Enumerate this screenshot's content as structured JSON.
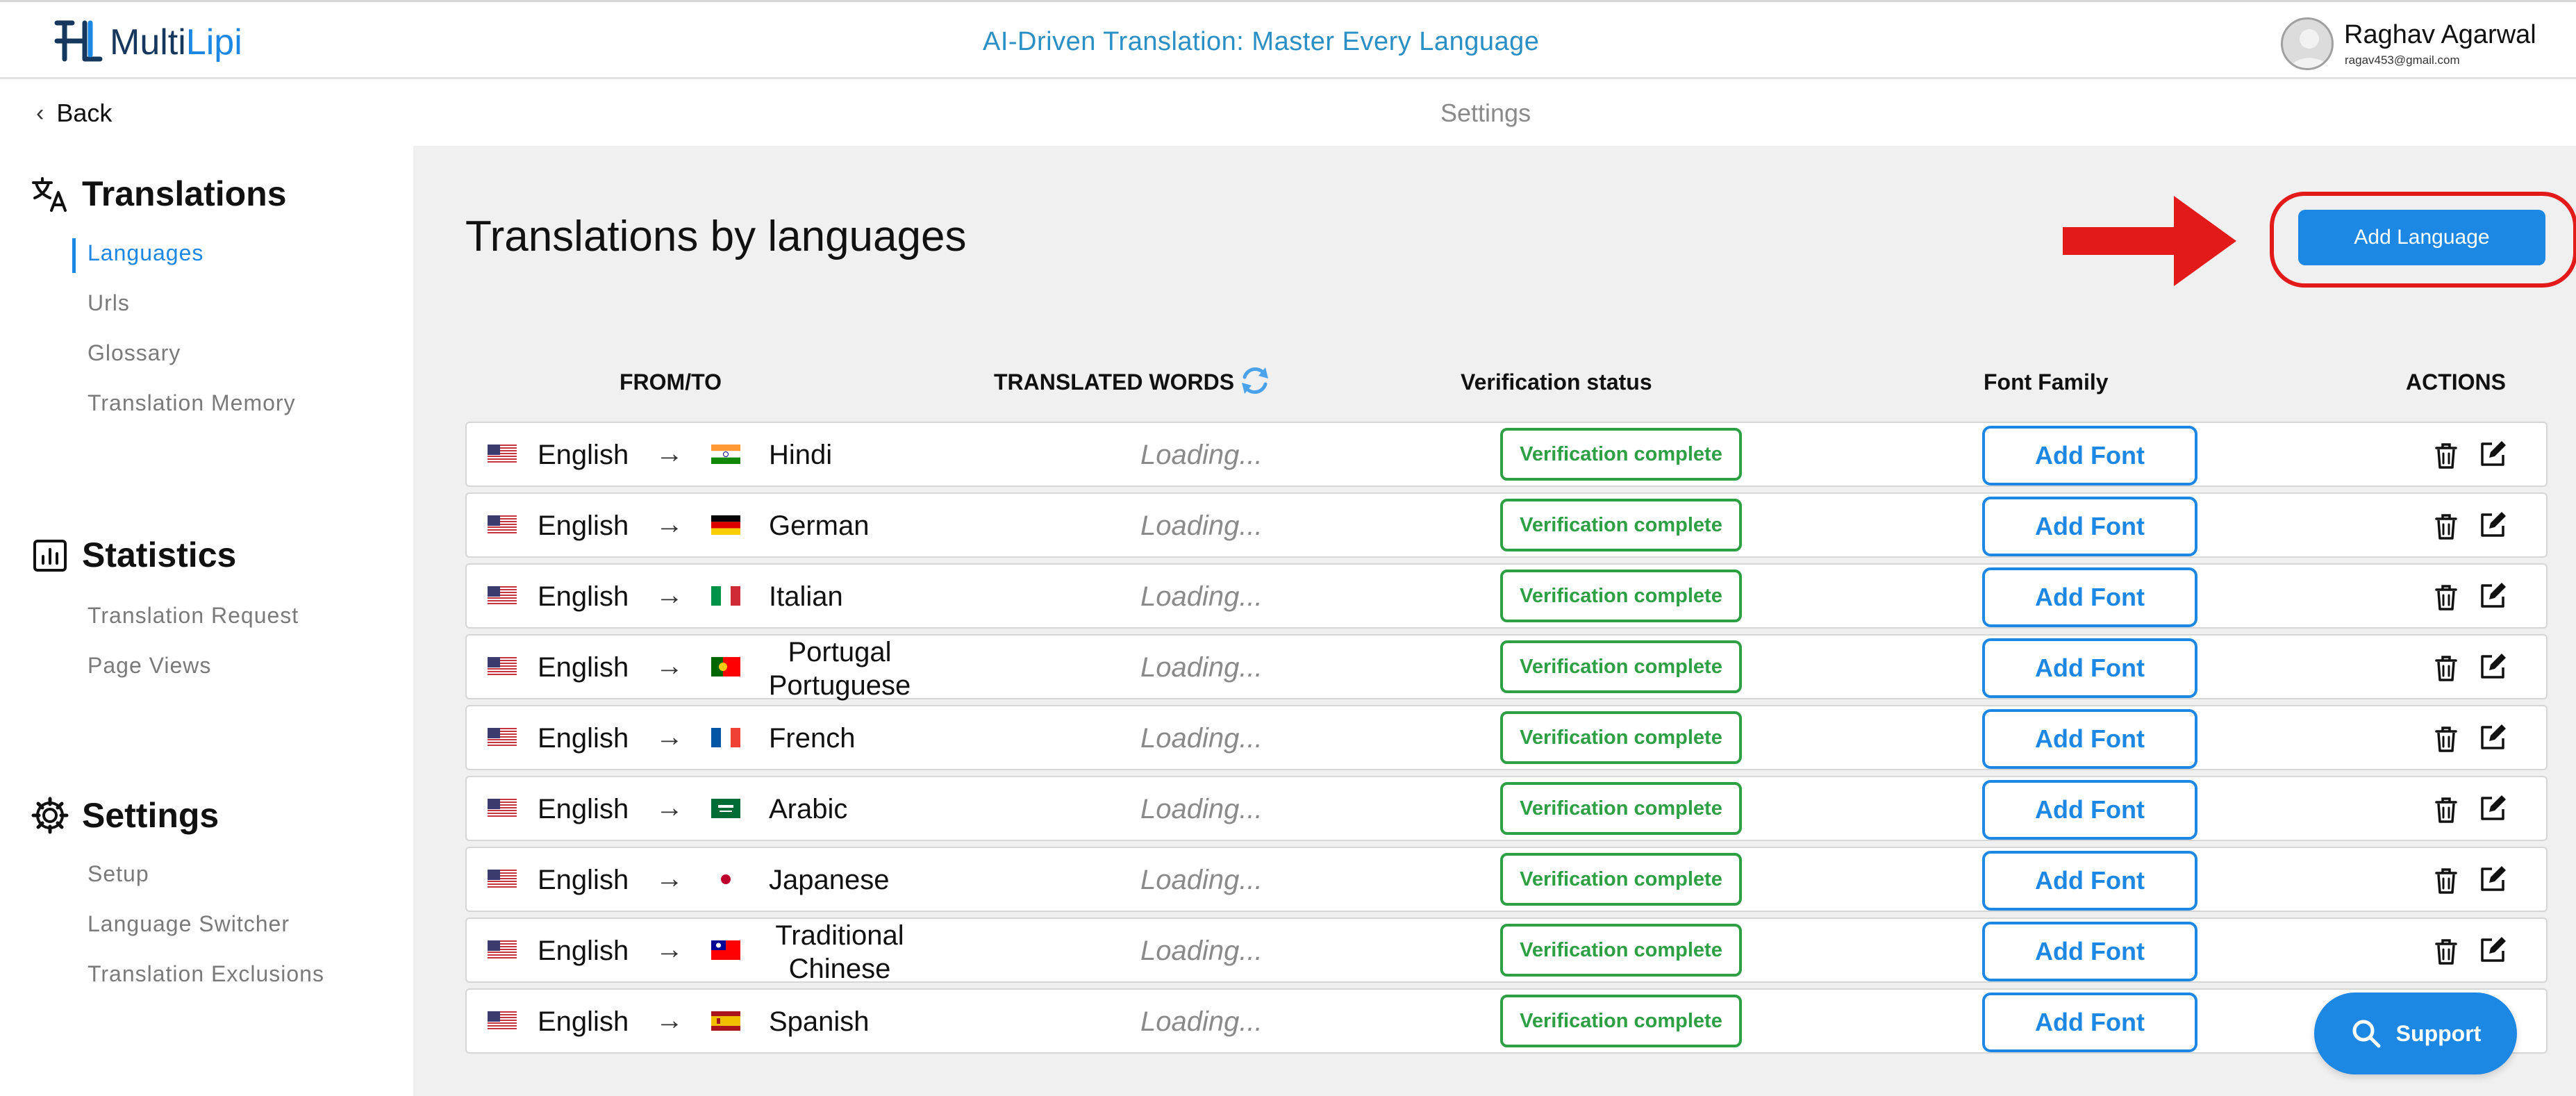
{
  "header": {
    "brand_multi": "Multi",
    "brand_lipi": "Lipi",
    "tagline": "AI-Driven Translation: Master Every Language",
    "user_name": "Raghav Agarwal",
    "user_email": "ragav453@gmail.com"
  },
  "subheader": {
    "back_label": "Back",
    "page_label": "Settings"
  },
  "sidebar": {
    "translations": {
      "title": "Translations",
      "items": [
        "Languages",
        "Urls",
        "Glossary",
        "Translation Memory"
      ],
      "active": "Languages"
    },
    "statistics": {
      "title": "Statistics",
      "items": [
        "Translation Request",
        "Page Views"
      ]
    },
    "settings": {
      "title": "Settings",
      "items": [
        "Setup",
        "Language Switcher",
        "Translation Exclusions"
      ]
    }
  },
  "main": {
    "title": "Translations by languages",
    "add_language_label": "Add Language",
    "columns": {
      "from_to": "FROM/TO",
      "translated_words": "TRANSLATED WORDS",
      "verification": "Verification status",
      "font_family": "Font Family",
      "actions": "ACTIONS"
    },
    "rows": [
      {
        "from": "English",
        "to": "Hindi",
        "to_lines": [
          "Hindi"
        ],
        "to_flag": "in",
        "words": "Loading...",
        "status": "Verification complete",
        "font_label": "Add Font"
      },
      {
        "from": "English",
        "to": "German",
        "to_lines": [
          "German"
        ],
        "to_flag": "de",
        "words": "Loading...",
        "status": "Verification complete",
        "font_label": "Add Font"
      },
      {
        "from": "English",
        "to": "Italian",
        "to_lines": [
          "Italian"
        ],
        "to_flag": "it",
        "words": "Loading...",
        "status": "Verification complete",
        "font_label": "Add Font"
      },
      {
        "from": "English",
        "to": "Portugal Portuguese",
        "to_lines": [
          "Portugal",
          "Portuguese"
        ],
        "to_flag": "pt",
        "words": "Loading...",
        "status": "Verification complete",
        "font_label": "Add Font"
      },
      {
        "from": "English",
        "to": "French",
        "to_lines": [
          "French"
        ],
        "to_flag": "fr",
        "words": "Loading...",
        "status": "Verification complete",
        "font_label": "Add Font"
      },
      {
        "from": "English",
        "to": "Arabic",
        "to_lines": [
          "Arabic"
        ],
        "to_flag": "sa",
        "words": "Loading...",
        "status": "Verification complete",
        "font_label": "Add Font"
      },
      {
        "from": "English",
        "to": "Japanese",
        "to_lines": [
          "Japanese"
        ],
        "to_flag": "jp",
        "words": "Loading...",
        "status": "Verification complete",
        "font_label": "Add Font"
      },
      {
        "from": "English",
        "to": "Traditional Chinese",
        "to_lines": [
          "Traditional",
          "Chinese"
        ],
        "to_flag": "tw",
        "words": "Loading...",
        "status": "Verification complete",
        "font_label": "Add Font"
      },
      {
        "from": "English",
        "to": "Spanish",
        "to_lines": [
          "Spanish"
        ],
        "to_flag": "es",
        "words": "Loading...",
        "status": "Verification complete",
        "font_label": "Add Font"
      }
    ],
    "source_flag": "us"
  },
  "support": {
    "label": "Support"
  },
  "icons": {
    "translate": "translate-icon",
    "statistics": "bar-chart-icon",
    "settings": "gear-icon",
    "refresh": "refresh-icon",
    "delete": "trash-icon",
    "edit": "edit-icon",
    "search": "search-icon",
    "arrow": "right-arrow-icon"
  },
  "colors": {
    "accent": "#1d87e4",
    "success": "#2ea044",
    "highlight": "#e21a1a",
    "tagline": "#2a8fc4"
  }
}
